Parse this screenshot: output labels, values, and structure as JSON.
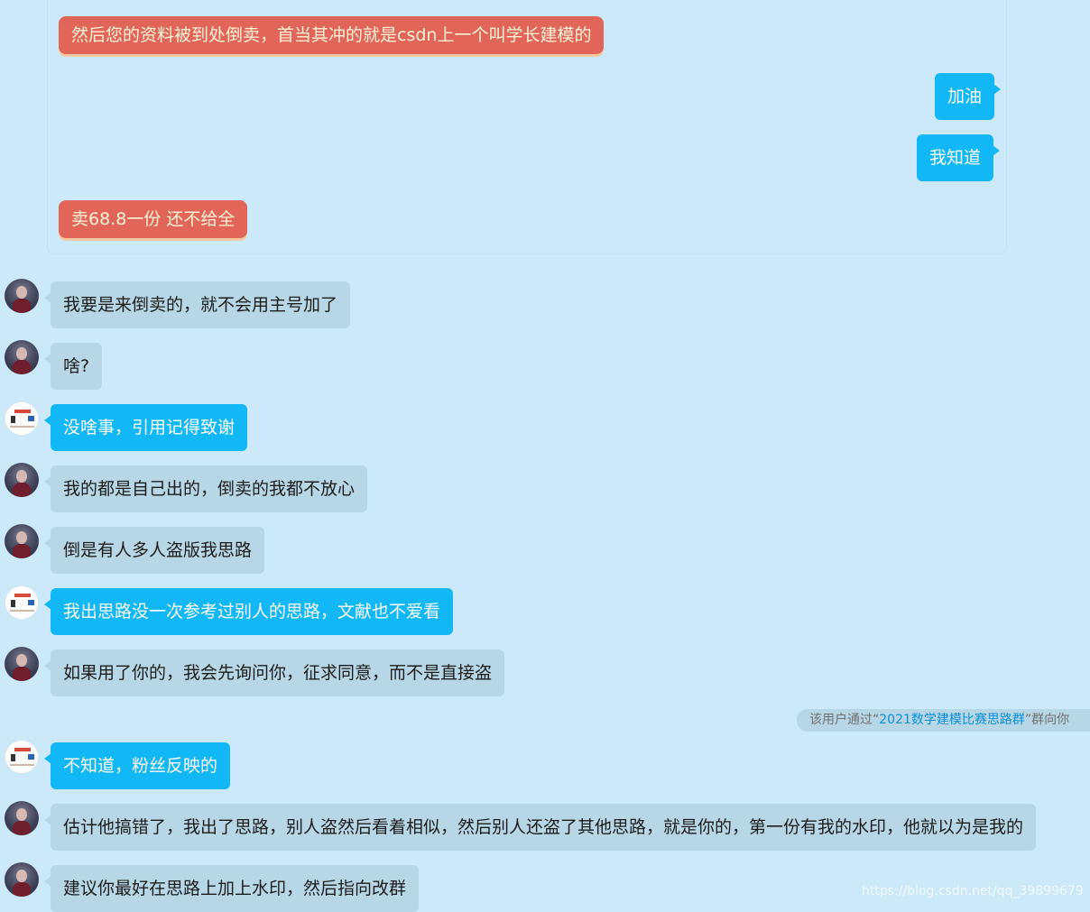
{
  "quoted": {
    "line1": "然后您的资料被到处倒卖，首当其冲的就是csdn上一个叫学长建模的",
    "reply1": "加油",
    "reply2": "我知道",
    "line2": "卖68.8一份 还不给全"
  },
  "messages": [
    {
      "sender": "other",
      "text": "我要是来倒卖的，就不会用主号加了"
    },
    {
      "sender": "other",
      "text": "啥?"
    },
    {
      "sender": "self",
      "text": "没啥事，引用记得致谢"
    },
    {
      "sender": "other",
      "text": "我的都是自己出的，倒卖的我都不放心"
    },
    {
      "sender": "other",
      "text": "倒是有人多人盗版我思路"
    },
    {
      "sender": "self",
      "text": "我出思路没一次参考过别人的思路，文献也不爱看"
    },
    {
      "sender": "other",
      "text": "如果用了你的，我会先询问你，征求同意，而不是直接盗"
    },
    {
      "sender": "self",
      "text": "不知道，粉丝反映的"
    },
    {
      "sender": "other",
      "text": "估计他搞错了，我出了思路，别人盗然后看着相似，然后别人还盗了其他思路，就是你的，第一份有我的水印，他就以为是我的"
    },
    {
      "sender": "other",
      "text": "建议你最好在思路上加上水印，然后指向改群"
    }
  ],
  "system_notice": {
    "prefix": "该用户通过“",
    "group": "2021数学建模比赛思路群",
    "suffix": "”群向你"
  },
  "watermark": "https://blog.csdn.net/qq_39899679",
  "colors": {
    "background": "#cbe9f9",
    "self_bubble": "#12b7f5",
    "other_bubble": "#b8d7e6",
    "quote_bubble": "#e2655a"
  }
}
